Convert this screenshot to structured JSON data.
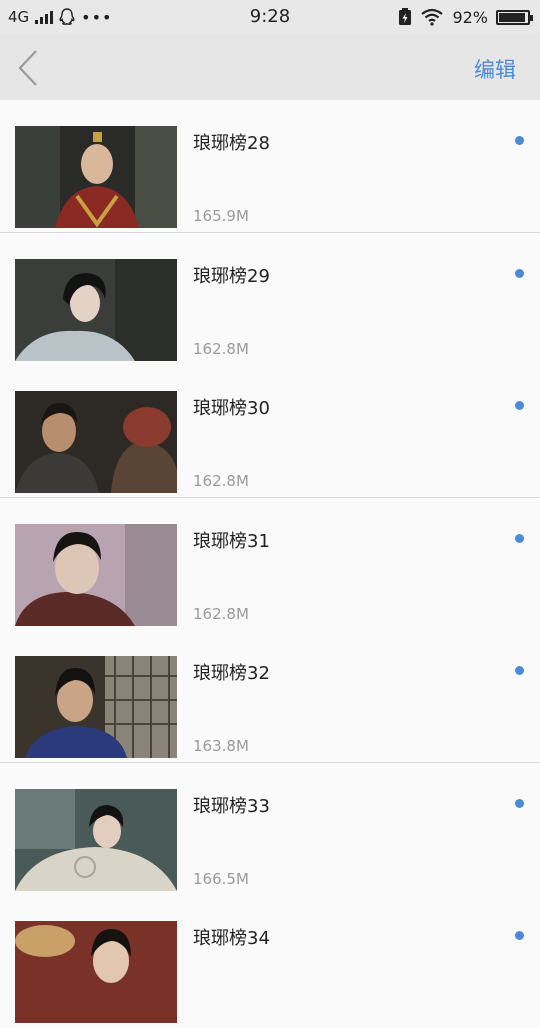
{
  "status_bar": {
    "network": "4G",
    "time": "9:28",
    "battery": "92%"
  },
  "header": {
    "edit_label": "编辑"
  },
  "videos": [
    {
      "title": "琅琊榜28",
      "size": "165.9M"
    },
    {
      "title": "琅琊榜29",
      "size": "162.8M"
    },
    {
      "title": "琅琊榜30",
      "size": "162.8M"
    },
    {
      "title": "琅琊榜31",
      "size": "162.8M"
    },
    {
      "title": "琅琊榜32",
      "size": "163.8M"
    },
    {
      "title": "琅琊榜33",
      "size": "166.5M"
    },
    {
      "title": "琅琊榜34",
      "size": ""
    }
  ],
  "icons": {
    "back": "back-chevron-icon",
    "new_marker": "blue-dot-icon",
    "qq": "qq-penguin-icon",
    "wifi": "wifi-icon",
    "battery": "battery-icon"
  },
  "colors": {
    "accent": "#4a8ad8"
  }
}
